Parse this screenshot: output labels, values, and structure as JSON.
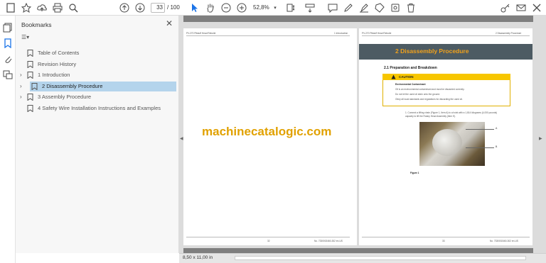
{
  "toolbar": {
    "current_page": "33",
    "page_total": "/ 100",
    "zoom": "52,8%"
  },
  "bookmarks": {
    "title": "Bookmarks",
    "items": [
      {
        "label": "Table of Contents",
        "expandable": false,
        "selected": false
      },
      {
        "label": "Revision History",
        "expandable": false,
        "selected": false
      },
      {
        "label": "1 Introduction",
        "expandable": true,
        "selected": false
      },
      {
        "label": "2 Disassembly Procedure",
        "expandable": true,
        "selected": true
      },
      {
        "label": "3 Assembly Procedure",
        "expandable": true,
        "selected": false
      },
      {
        "label": "4 Safety Wire Installation Instructions and Examples",
        "expandable": false,
        "selected": false
      }
    ]
  },
  "page_left": {
    "header_left": "PV-270 Pitstuff Head Rebuild",
    "header_right": "1 Introduction",
    "page_number": "32",
    "doc_number": "No. 7330002460-302 en-US"
  },
  "page_right": {
    "header_left": "PV-270 Pitstuff Head Rebuild",
    "header_right": "2 Disassembly Procedure",
    "section_title": "2 Disassembly Procedure",
    "subsection": "2.1   Preparation and Breakdown",
    "caution_label": "CAUTION",
    "caution_heading": "Environmental Contaminant",
    "caution_text": "Oil is an environmental contaminant and must be discarded correctly.",
    "caution_bullets": [
      "Do not let the used oil drain onto the ground.",
      "Obey all local standards and regulations for discarding the used oil."
    ],
    "step_text": "1.   Connect a lifting chain (Figure 1, Item A) to a hoist with a 1,814 kilograms (4,000 pounds) capacity to lift the Rotary Head Assembly (Item E).",
    "figure_label": "Figure 1",
    "callout_a": "A",
    "callout_b": "B",
    "page_number": "33",
    "doc_number": "No. 7330002460-302 en-US"
  },
  "watermark": "machinecatalogic.com",
  "status": {
    "page_size": "8,50 x 11,00 in"
  }
}
